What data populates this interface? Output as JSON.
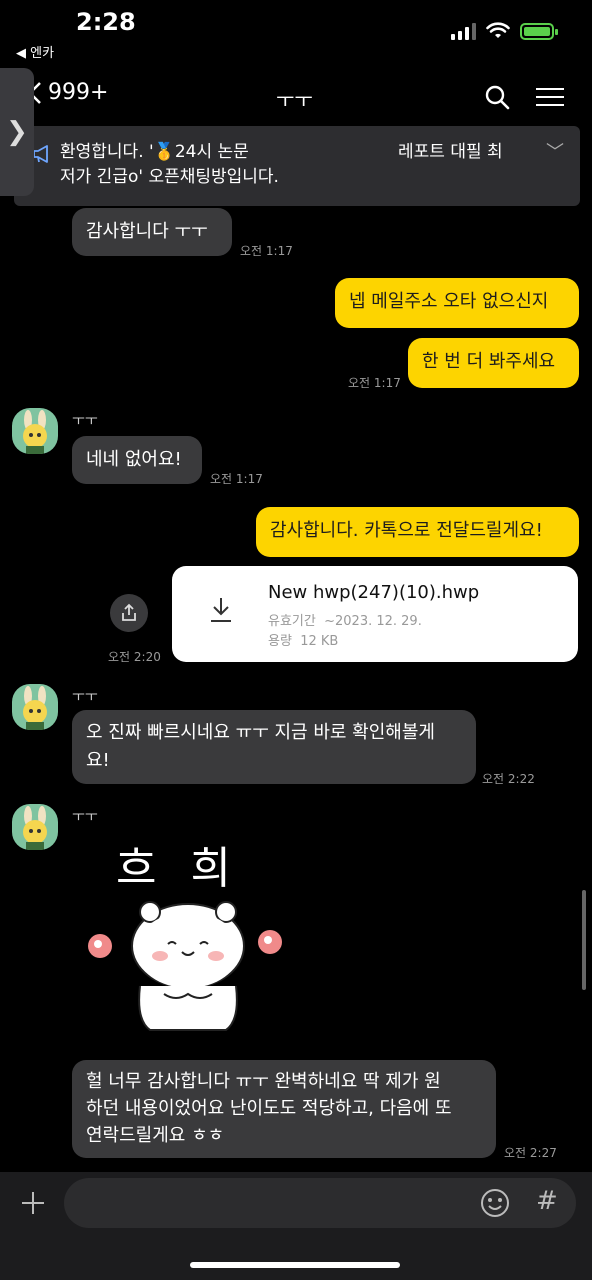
{
  "status": {
    "time": "2:28",
    "back_app": "◀ 엔카"
  },
  "nav": {
    "back_count": "999+",
    "title": "ㅜㅜ"
  },
  "notice": {
    "line1": "환영합니다. '🥇24시 논문",
    "line1_tail": "레포트 대필 최",
    "line2": "저가 긴급o' 오픈채팅방입니다."
  },
  "messages": {
    "m1": {
      "text": "감사합니다 ㅜㅜ",
      "time": "오전 1:17"
    },
    "m2": {
      "text": "넵 메일주소 오타 없으신지"
    },
    "m3": {
      "text": "한 번 더 봐주세요",
      "time": "오전 1:17"
    },
    "m4": {
      "nick": "ㅜㅜ",
      "text": "네네 없어요!",
      "time": "오전 1:17"
    },
    "m5": {
      "text": "감사합니다. 카톡으로 전달드릴게요!"
    },
    "file": {
      "name": "New hwp(247)(10).hwp",
      "expiry_label": "유효기간",
      "expiry": "~2023. 12. 29.",
      "size_label": "용량",
      "size": "12 KB",
      "time": "오전 2:20"
    },
    "m6": {
      "nick": "ㅜㅜ",
      "line1": "오 진짜 빠르시네요 ㅠㅜ 지금 바로 확인해볼게",
      "line2": "요!",
      "time": "오전 2:22"
    },
    "m7": {
      "nick": "ㅜㅜ",
      "sticker_text": "흐 희",
      "line1": "헐 너무 감사합니다 ㅠㅜ 완벽하네요 딱 제가 원",
      "line2": "하던 내용이었어요 난이도도 적당하고, 다음에 또",
      "line3": "연락드릴게요 ㅎㅎ",
      "time": "오전 2:27"
    }
  },
  "input": {
    "hash": "#"
  },
  "colors": {
    "my_bubble": "#fdd400",
    "other_bubble": "#3a3a3c",
    "background": "#000000"
  }
}
